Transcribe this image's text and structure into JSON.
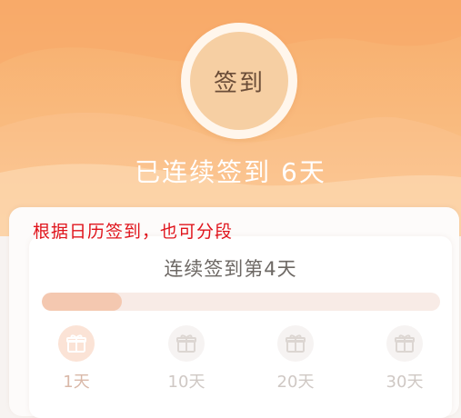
{
  "checkin": {
    "button_label": "签到",
    "streak_text": "已连续签到 6天"
  },
  "annotation": "根据日历签到，也可分段",
  "progress": {
    "label": "连续签到第4天",
    "value_fraction": 0.2
  },
  "milestones": [
    {
      "label": "1天",
      "active": true
    },
    {
      "label": "10天",
      "active": false
    },
    {
      "label": "20天",
      "active": false
    },
    {
      "label": "30天",
      "active": false
    }
  ],
  "colors": {
    "header_top": "#f8ad6b",
    "header_bottom": "#fbd2a3",
    "button_fill": "#f6cfa3",
    "annotation": "#e0141c",
    "progress_fill": "#f4c8b0"
  },
  "icons": {
    "milestone": "gift-icon"
  }
}
